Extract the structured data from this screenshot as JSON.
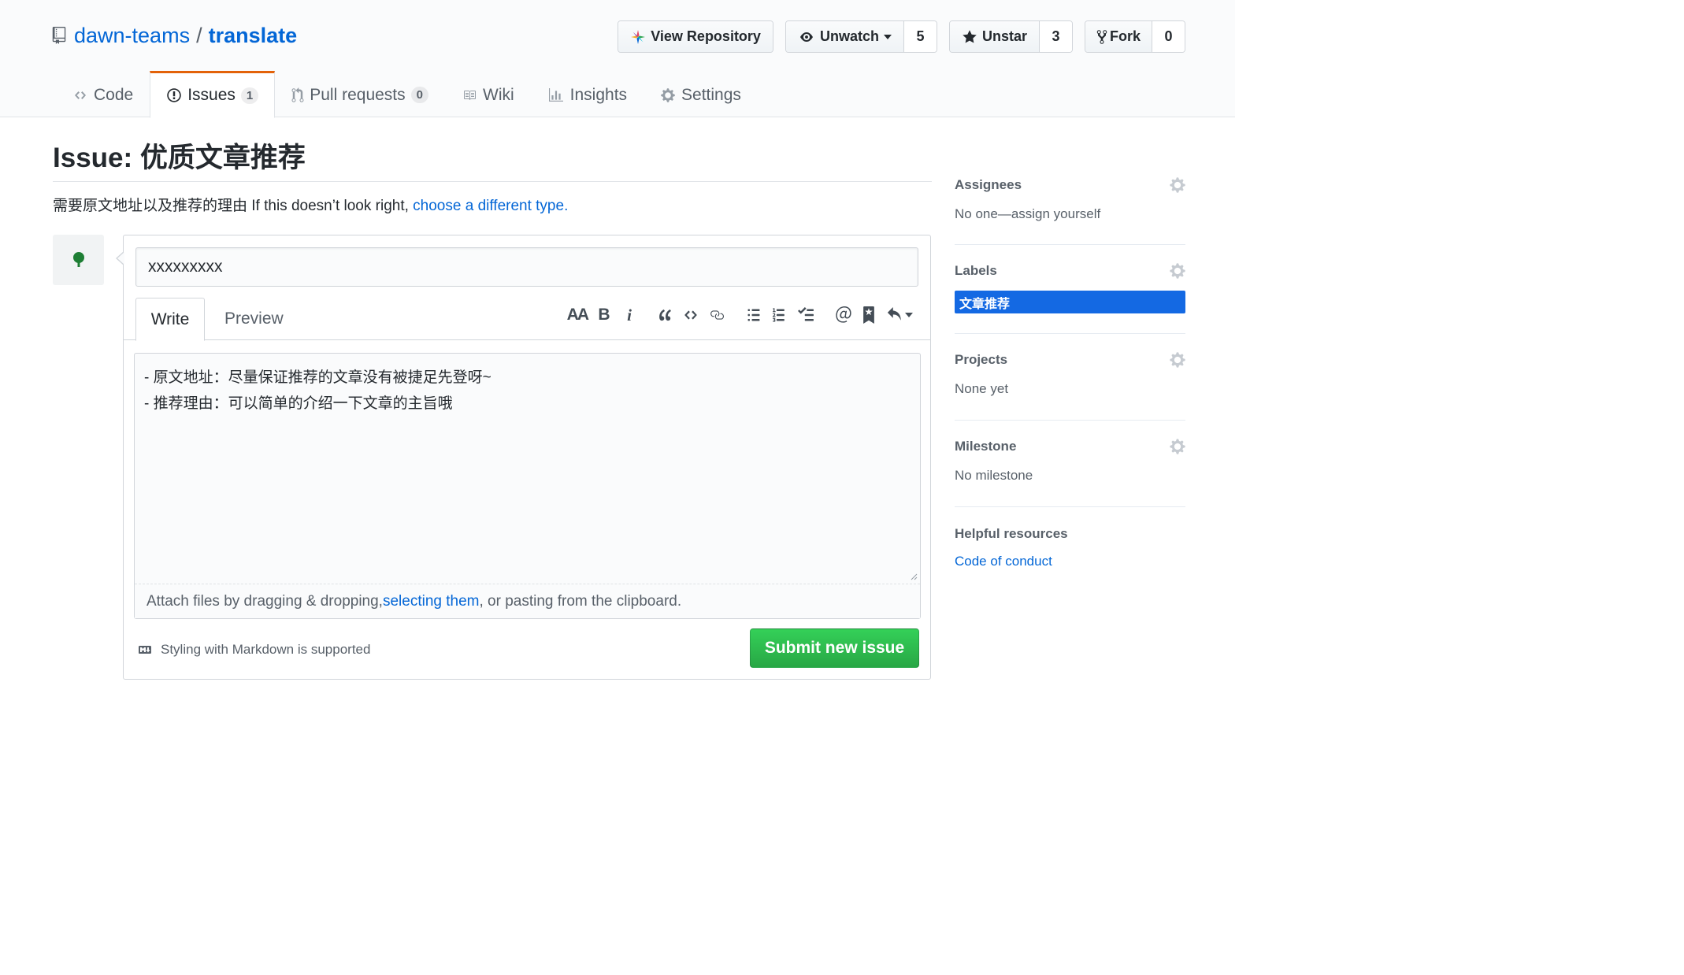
{
  "repo": {
    "owner": "dawn-teams",
    "separator": "/",
    "name": "translate"
  },
  "actions": {
    "view_repository": "View Repository",
    "unwatch": "Unwatch",
    "watch_count": "5",
    "unstar": "Unstar",
    "star_count": "3",
    "fork": "Fork",
    "fork_count": "0"
  },
  "nav": {
    "code": "Code",
    "issues": "Issues",
    "issues_count": "1",
    "pull_requests": "Pull requests",
    "pull_requests_count": "0",
    "wiki": "Wiki",
    "insights": "Insights",
    "settings": "Settings"
  },
  "issue": {
    "title": "Issue: 优质文章推荐",
    "subtitle_text": "需要原文地址以及推荐的理由 If this doesn’t look right, ",
    "subtitle_link": "choose a different type."
  },
  "form": {
    "title_value": "xxxxxxxxx",
    "tab_write": "Write",
    "tab_preview": "Preview",
    "toolbar": {
      "header": "AA",
      "bold": "B",
      "italic": "i"
    },
    "body_lines": [
      "- 原文地址：尽量保证推荐的文章没有被捷足先登呀~",
      "- 推荐理由：可以简单的介绍一下文章的主旨哦"
    ],
    "attach_before": "Attach files by dragging & dropping, ",
    "attach_link": "selecting them",
    "attach_after": ", or pasting from the clipboard.",
    "markdown_note": "Styling with Markdown is supported",
    "submit_label": "Submit new issue"
  },
  "sidebar": {
    "assignees": {
      "heading": "Assignees",
      "value": "No one—assign yourself"
    },
    "labels": {
      "heading": "Labels",
      "value": "文章推荐",
      "color": "#1469e3"
    },
    "projects": {
      "heading": "Projects",
      "value": "None yet"
    },
    "milestone": {
      "heading": "Milestone",
      "value": "No milestone"
    },
    "resources": {
      "heading": "Helpful resources",
      "link": "Code of conduct"
    }
  },
  "colors": {
    "accent_link": "#0366d6",
    "submit_green": "#28a745",
    "tab_highlight": "#e36209"
  }
}
